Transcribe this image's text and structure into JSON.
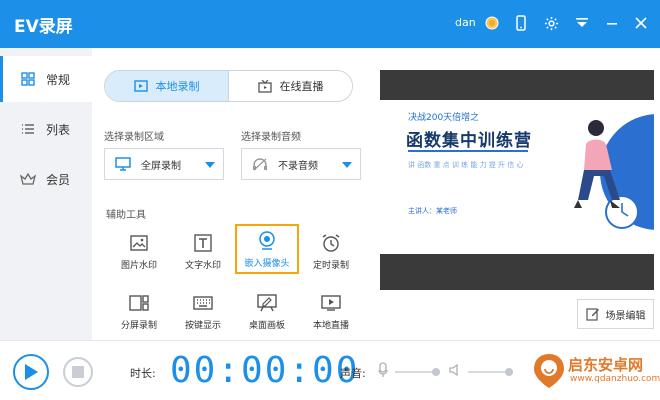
{
  "window": {
    "title": "EV录屏",
    "user": "dan",
    "icons": [
      "coin-icon",
      "phone-icon",
      "settings-icon",
      "menu-icon",
      "minimize-icon",
      "close-icon"
    ]
  },
  "sidebar": {
    "items": [
      {
        "label": "常规",
        "icon": "grid-icon",
        "active": true
      },
      {
        "label": "列表",
        "icon": "list-icon",
        "active": false
      },
      {
        "label": "会员",
        "icon": "crown-icon",
        "active": false
      }
    ]
  },
  "modes": {
    "local": "本地录制",
    "live": "在线直播"
  },
  "record_area": {
    "label": "选择录制区域",
    "value": "全屏录制"
  },
  "record_audio": {
    "label": "选择录制音频",
    "value": "不录音频"
  },
  "tools": {
    "label": "辅助工具",
    "items": [
      {
        "label": "图片水印",
        "icon": "image-icon"
      },
      {
        "label": "文字水印",
        "icon": "text-icon"
      },
      {
        "label": "嵌入摄像头",
        "icon": "webcam-icon"
      },
      {
        "label": "定时录制",
        "icon": "alarm-icon"
      },
      {
        "label": "分屏录制",
        "icon": "split-screen-icon"
      },
      {
        "label": "按键显示",
        "icon": "keyboard-icon"
      },
      {
        "label": "桌面画板",
        "icon": "drawing-board-icon"
      },
      {
        "label": "本地直播",
        "icon": "live-icon"
      }
    ]
  },
  "preview": {
    "subtitle": "决战200天倍增之",
    "title": "函数集中训练营",
    "desc": "讲  函数  重  点    训  练  能  力  提  升  信  心",
    "presenter": "主讲人：某老师"
  },
  "scene_button": "场景编辑",
  "bottom": {
    "duration_label": "时长:",
    "timer": "00:00:00",
    "volume_label": "声音:"
  },
  "watermark": {
    "text": "启东安卓网",
    "url": "www.qdanzhuo.com"
  },
  "colors": {
    "accent": "#1c8fe8",
    "highlight": "#f5a60b"
  }
}
